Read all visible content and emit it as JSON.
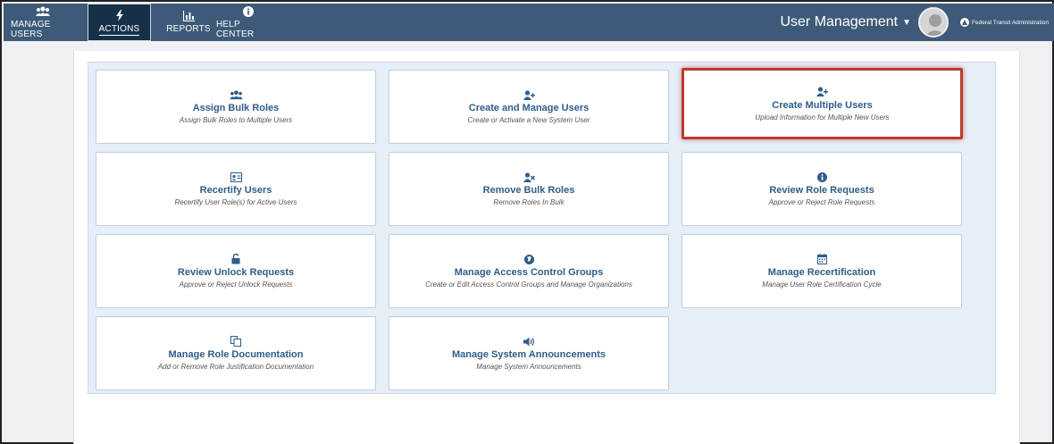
{
  "nav": {
    "items": [
      {
        "label": "MANAGE USERS",
        "icon": "users-icon"
      },
      {
        "label": "ACTIONS",
        "icon": "bolt-icon"
      },
      {
        "label": "REPORTS",
        "icon": "bar-chart-icon"
      },
      {
        "label": "HELP CENTER",
        "icon": "info-icon"
      }
    ]
  },
  "user_menu": {
    "label": "User Management",
    "caret": "▼"
  },
  "agency": {
    "name": "Federal Transit Administration"
  },
  "colors": {
    "nav_bg": "#3d5a78",
    "active_bg": "#163049",
    "title": "#2e5d8a",
    "highlight": "#c0392b"
  },
  "cards": [
    {
      "title": "Assign Bulk Roles",
      "desc": "Assign Bulk Roles to Multiple Users",
      "icon": "users-icon"
    },
    {
      "title": "Create and Manage Users",
      "desc": "Create or Activate a New System User",
      "icon": "user-plus-icon"
    },
    {
      "title": "Create Multiple Users",
      "desc": "Upload Information for Multiple New Users",
      "icon": "user-plus-icon"
    },
    {
      "title": "Recertify Users",
      "desc": "Recertify User Role(s) for Active Users",
      "icon": "id-card-icon"
    },
    {
      "title": "Remove Bulk Roles",
      "desc": "Remove Roles In Bulk",
      "icon": "user-times-icon"
    },
    {
      "title": "Review Role Requests",
      "desc": "Approve or Reject Role Requests",
      "icon": "info-circle-icon"
    },
    {
      "title": "Review Unlock Requests",
      "desc": "Approve or Reject Unlock Requests",
      "icon": "unlock-icon"
    },
    {
      "title": "Manage Access Control Groups",
      "desc": "Create or Edit Access Control Groups and Manage Organizations",
      "icon": "globe-icon"
    },
    {
      "title": "Manage Recertification",
      "desc": "Manage User Role Certification Cycle",
      "icon": "calendar-icon"
    },
    {
      "title": "Manage Role Documentation",
      "desc": "Add or Remove Role Justification Documentation",
      "icon": "copy-icon"
    },
    {
      "title": "Manage System Announcements",
      "desc": "Manage System Announcements",
      "icon": "volume-icon"
    }
  ]
}
